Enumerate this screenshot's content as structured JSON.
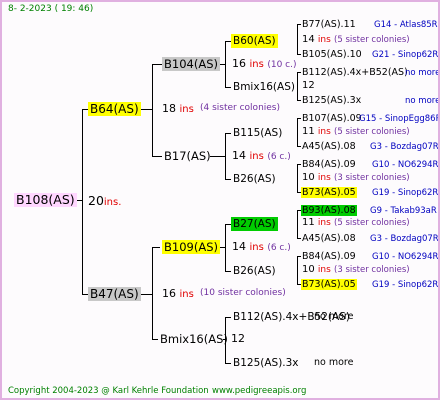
{
  "header": {
    "date": "8-  2-2023 ( 19: 46)"
  },
  "footer": {
    "copyright": "Copyright 2004-2023 @ Karl Kehrle Foundation",
    "site": "www.pedigreeapis.org"
  },
  "root": {
    "name": "B108(AS)",
    "num": "20",
    "ins": "ins."
  },
  "g1_top": {
    "name": "B64(AS)",
    "num": "18",
    "ins": "ins",
    "sisters": "(4 sister colonies)"
  },
  "g1_bot": {
    "name": "B47(AS)",
    "num": "16",
    "ins": "ins",
    "sisters": "(10 sister colonies)"
  },
  "g2": {
    "b104": {
      "name": "B104(AS)",
      "num": "16",
      "ins": "ins",
      "sisters": "(10 c.)"
    },
    "b17": {
      "name": "B17(AS)",
      "num": "14",
      "ins": "ins",
      "sisters": "(6 c.)"
    },
    "b109": {
      "name": "B109(AS)",
      "num": "14",
      "ins": "ins",
      "sisters": "(6 c.)"
    },
    "bmix16": {
      "name": "Bmix16(AS)",
      "num": "12"
    }
  },
  "g3": {
    "b60": {
      "name": "B60(AS)",
      "num": "14",
      "ins": "ins",
      "sisters": "(5 sister colonies)"
    },
    "bmix16b": {
      "name": "Bmix16(AS)",
      "num": "12"
    },
    "b115": {
      "name": "B115(AS)",
      "num": "11",
      "ins": "ins",
      "sisters": "(5 sister colonies)"
    },
    "b26a": {
      "name": "B26(AS)",
      "num": "10",
      "ins": "ins",
      "sisters": "(3 sister colonies)"
    },
    "b27": {
      "name": "B27(AS)",
      "num": "11",
      "ins": "ins",
      "sisters": "(5 sister colonies)"
    },
    "b26b": {
      "name": "B26(AS)",
      "num": "10",
      "ins": "ins",
      "sisters": "(3 sister colonies)"
    },
    "b112": {
      "name": "B112(AS).4x+B52(AS)",
      "extra": "no more"
    },
    "b125": {
      "name": "B125(AS).3x",
      "extra": "no more"
    }
  },
  "g4": [
    {
      "name": "B77(AS).11",
      "right": "G14 - Atlas85R"
    },
    {
      "name": "B105(AS).10",
      "right": "G21 - Sinop62R"
    },
    {
      "name": "B112(AS).4x+B52(AS)",
      "right": "no more"
    },
    {
      "name": "B125(AS).3x",
      "right": "no more"
    },
    {
      "name": "B107(AS).09",
      "right": "G15 - SinopEgg86R"
    },
    {
      "name": "A45(AS).08",
      "right": "G3 - Bozdag07R"
    },
    {
      "name": "B84(AS).09",
      "right": "G10 - NO6294R"
    },
    {
      "name": "B73(AS).05",
      "right": "G19 - Sinop62R"
    },
    {
      "name": "B93(AS).08",
      "right": "G9 - Takab93aR"
    },
    {
      "name": "A45(AS).08",
      "right": "G3 - Bozdag07R"
    },
    {
      "name": "B84(AS).09",
      "right": "G10 - NO6294R"
    },
    {
      "name": "B73(AS).05",
      "right": "G19 - Sinop62R"
    }
  ]
}
